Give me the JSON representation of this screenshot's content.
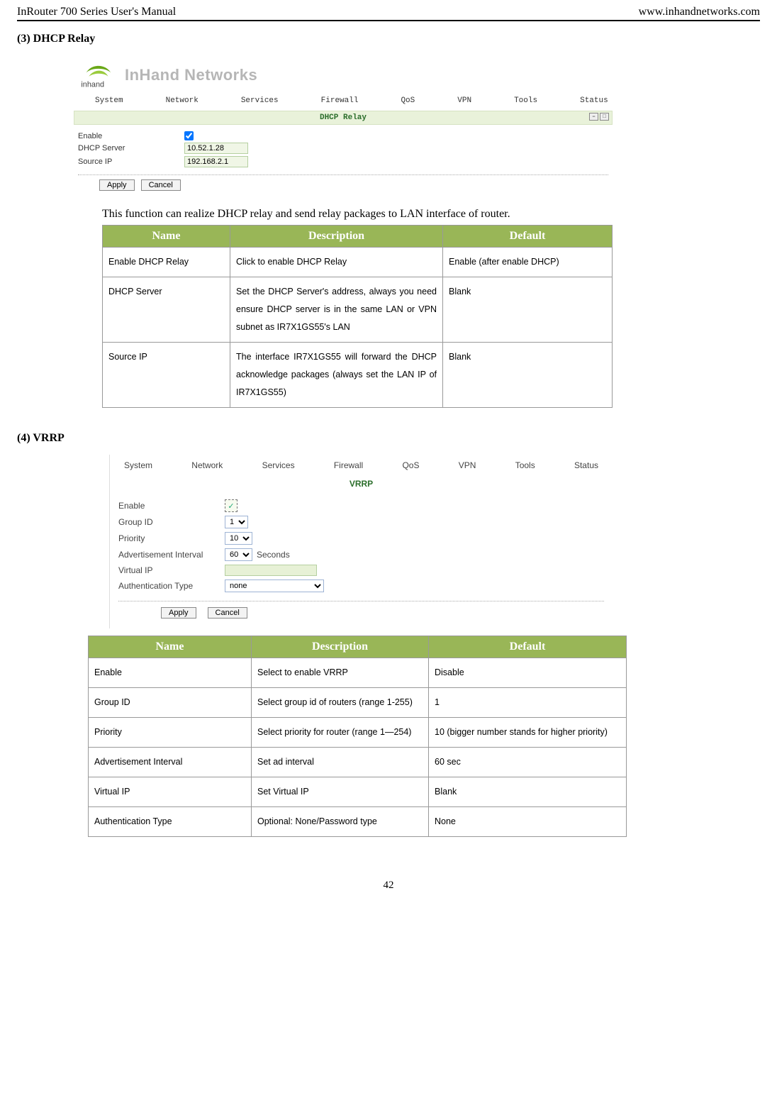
{
  "header": {
    "left": "InRouter 700 Series User's Manual",
    "right": "www.inhandnetworks.com"
  },
  "section3": {
    "heading": "(3)  DHCP Relay",
    "logo_text": "InHand Networks",
    "nav": [
      "System",
      "Network",
      "Services",
      "Firewall",
      "QoS",
      "VPN",
      "Tools",
      "Status"
    ],
    "panel_title": "DHCP Relay",
    "form": {
      "enable_label": "Enable",
      "dhcp_server_label": "DHCP Server",
      "dhcp_server_value": "10.52.1.28",
      "source_ip_label": "Source IP",
      "source_ip_value": "192.168.2.1",
      "apply": "Apply",
      "cancel": "Cancel"
    },
    "caption": "This function can realize DHCP relay and send relay packages to LAN interface of router.",
    "table": {
      "head": [
        "Name",
        "Description",
        "Default"
      ],
      "rows": [
        {
          "name": "Enable DHCP Relay",
          "desc": "Click to enable DHCP Relay",
          "def": "Enable (after enable DHCP)"
        },
        {
          "name": "DHCP Server",
          "desc": "Set the DHCP Server's address, always you need ensure DHCP server is in the same LAN or VPN subnet as IR7X1GS55's LAN",
          "def": "Blank"
        },
        {
          "name": "Source IP",
          "desc": "The interface IR7X1GS55 will forward the DHCP acknowledge packages (always set the LAN IP of IR7X1GS55)",
          "def": "Blank"
        }
      ]
    }
  },
  "section4": {
    "heading": "(4)  VRRP",
    "nav": [
      "System",
      "Network",
      "Services",
      "Firewall",
      "QoS",
      "VPN",
      "Tools",
      "Status"
    ],
    "panel_title": "VRRP",
    "form": {
      "enable_label": "Enable",
      "group_id_label": "Group ID",
      "group_id_value": "1",
      "priority_label": "Priority",
      "priority_value": "10",
      "ad_interval_label": "Advertisement Interval",
      "ad_interval_value": "60",
      "ad_interval_unit": "Seconds",
      "virtual_ip_label": "Virtual IP",
      "auth_type_label": "Authentication Type",
      "auth_type_value": "none",
      "apply": "Apply",
      "cancel": "Cancel"
    },
    "table": {
      "head": [
        "Name",
        "Description",
        "Default"
      ],
      "rows": [
        {
          "name": "Enable",
          "desc": "Select to enable VRRP",
          "def": "Disable"
        },
        {
          "name": "Group ID",
          "desc": "Select group id of routers (range 1-255)",
          "def": "1"
        },
        {
          "name": "Priority",
          "desc": "Select priority for router (range 1—254)",
          "def": "10 (bigger number stands for higher priority)"
        },
        {
          "name": "Advertisement Interval",
          "desc": "Set ad interval",
          "def": "60 sec"
        },
        {
          "name": "Virtual IP",
          "desc": "Set Virtual IP",
          "def": "Blank"
        },
        {
          "name": "Authentication Type",
          "desc": "Optional: None/Password type",
          "def": "None"
        }
      ]
    }
  },
  "page_number": "42"
}
